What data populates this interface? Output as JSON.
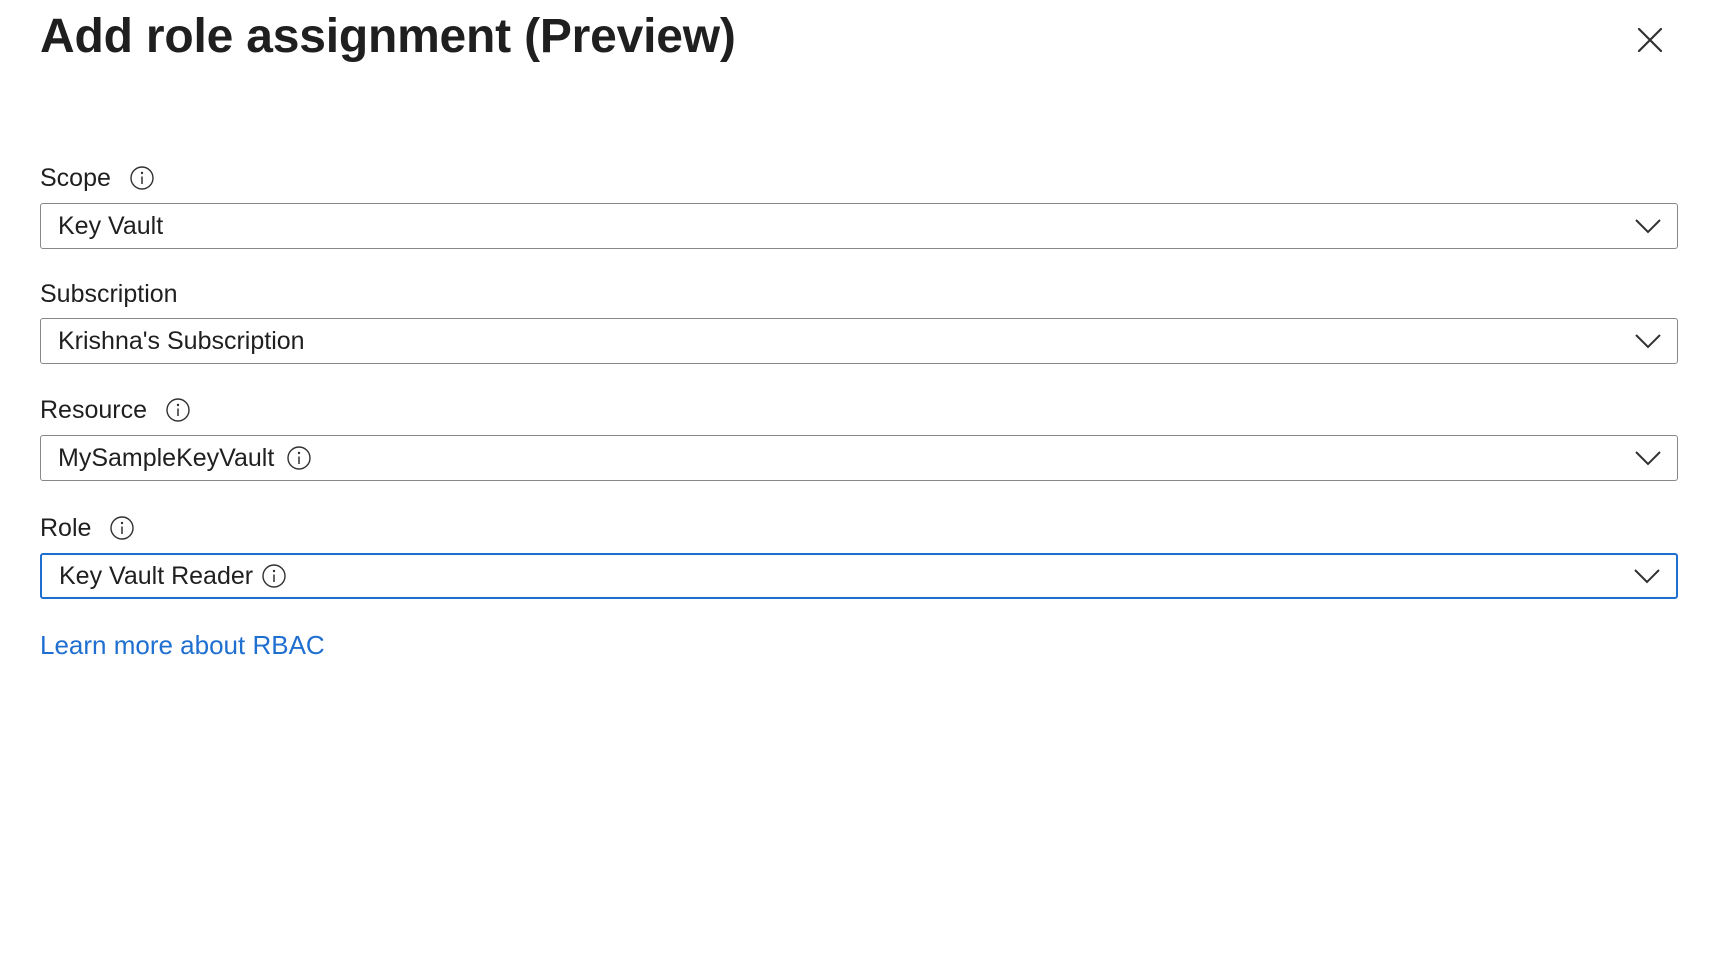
{
  "panel": {
    "title": "Add role assignment (Preview)",
    "close_icon": "close-icon"
  },
  "fields": {
    "scope": {
      "label": "Scope",
      "value": "Key Vault",
      "has_info_icon": true
    },
    "subscription": {
      "label": "Subscription",
      "value": "Krishna's Subscription",
      "has_info_icon": false
    },
    "resource": {
      "label": "Resource",
      "value": "MySampleKeyVault",
      "has_info_icon": true,
      "value_has_info_icon": true
    },
    "role": {
      "label": "Role",
      "value": "Key Vault Reader",
      "has_info_icon": true,
      "value_has_info_icon": true,
      "focused": true
    }
  },
  "links": {
    "learn_more": "Learn more about RBAC"
  },
  "colors": {
    "text": "#1f1f1f",
    "border": "#8a8886",
    "focus_border": "#1f6fd1",
    "link": "#1f6fd1",
    "icon": "#323130"
  }
}
